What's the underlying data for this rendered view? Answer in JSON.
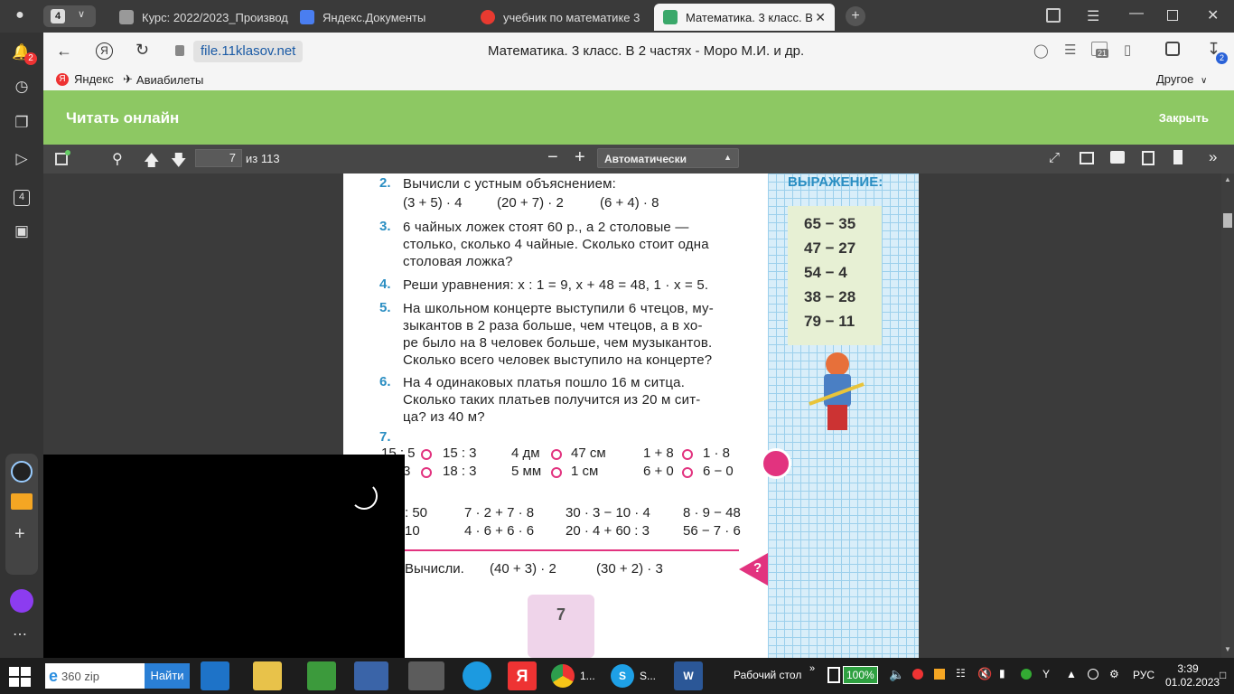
{
  "tabs": {
    "count": "4",
    "items": [
      {
        "label": "Курс: 2022/2023_Производ",
        "color": "#888"
      },
      {
        "label": "Яндекс.Документы",
        "color": "#4a7ef0"
      },
      {
        "label": "учебник по математике 3",
        "color": "#e83a30"
      },
      {
        "label": "Математика. 3 класс. В",
        "color": "#3aa86a"
      }
    ]
  },
  "address": {
    "domain": "file.11klasov.net",
    "title": "Математика. 3 класс. В 2 частях - Моро М.И. и др.",
    "download_badge": "2",
    "tab_badge": "21"
  },
  "bookmarks": {
    "yandex": "Яндекс",
    "avia": "Авиабилеты",
    "other": "Другое"
  },
  "header": {
    "read": "Читать онлайн",
    "close": "Закрыть"
  },
  "pdf": {
    "page": "7",
    "of": "из 113",
    "zoom": "Автоматически"
  },
  "sidebar": {
    "notif_badge": "2",
    "counter": "4"
  },
  "book": {
    "t2": {
      "n": "2.",
      "text": "Вычисли с устным объяснением:",
      "exprs": [
        "(3 + 5) · 4",
        "(20 + 7) · 2",
        "(6 + 4) · 8"
      ]
    },
    "t3": {
      "n": "3.",
      "lines": [
        "6 чайных ложек стоят 60 р., а 2 столовые —",
        "столько, сколько 4 чайные. Сколько стоит одна",
        "столовая ложка?"
      ]
    },
    "t4": {
      "n": "4.",
      "text": "Реши уравнения:  x : 1 = 9,   x + 48 = 48,   1 · x = 5."
    },
    "t5": {
      "n": "5.",
      "lines": [
        "На школьном концерте выступили 6 чтецов, му-",
        "зыкантов в 2 раза больше, чем чтецов, а в хо-",
        "ре было на 8 человек больше, чем музыкантов.",
        "Сколько всего человек выступило на концерте?"
      ]
    },
    "t6": {
      "n": "6.",
      "lines": [
        "На 4 одинаковых платья пошло 16 м ситца.",
        "Сколько таких платьев получится из 20 м сит-",
        "ца?  из 40 м?"
      ]
    },
    "t7": {
      "n": "7.",
      "r1": [
        "15 : 5",
        "15 : 3",
        "4 дм",
        "47 см",
        "1 + 8",
        "1 · 8"
      ],
      "r2": [
        "3",
        "18 : 3",
        "5 мм",
        "1 см",
        "6 + 0",
        "6 − 0"
      ]
    },
    "t8": {
      "r1": [
        ": 50",
        "7 · 2 + 7 · 8",
        "30 · 3 − 10 · 4",
        "8 · 9 − 48"
      ],
      "r2": [
        "10",
        "4 · 6 + 6 · 6",
        "20 · 4 + 60 : 3",
        "56 − 7 · 6"
      ]
    },
    "t9": {
      "label": "Вычисли.",
      "e1": "(40 + 3) · 2",
      "e2": "(30 + 2) · 3"
    },
    "page_number": "7",
    "expr_title": "ВЫРАЖЕНИЕ:",
    "expr": [
      "65 − 35",
      "47 − 27",
      "54 − 4",
      "38 − 28",
      "79 − 11"
    ]
  },
  "taskbar": {
    "search": "360 zip",
    "find": "Найти",
    "desk": "Рабочий стол",
    "battery": "100%",
    "lang": "РУС",
    "time": "3:39",
    "date": "01.02.2023",
    "chrome_label": "1...",
    "skype_label": "S..."
  }
}
